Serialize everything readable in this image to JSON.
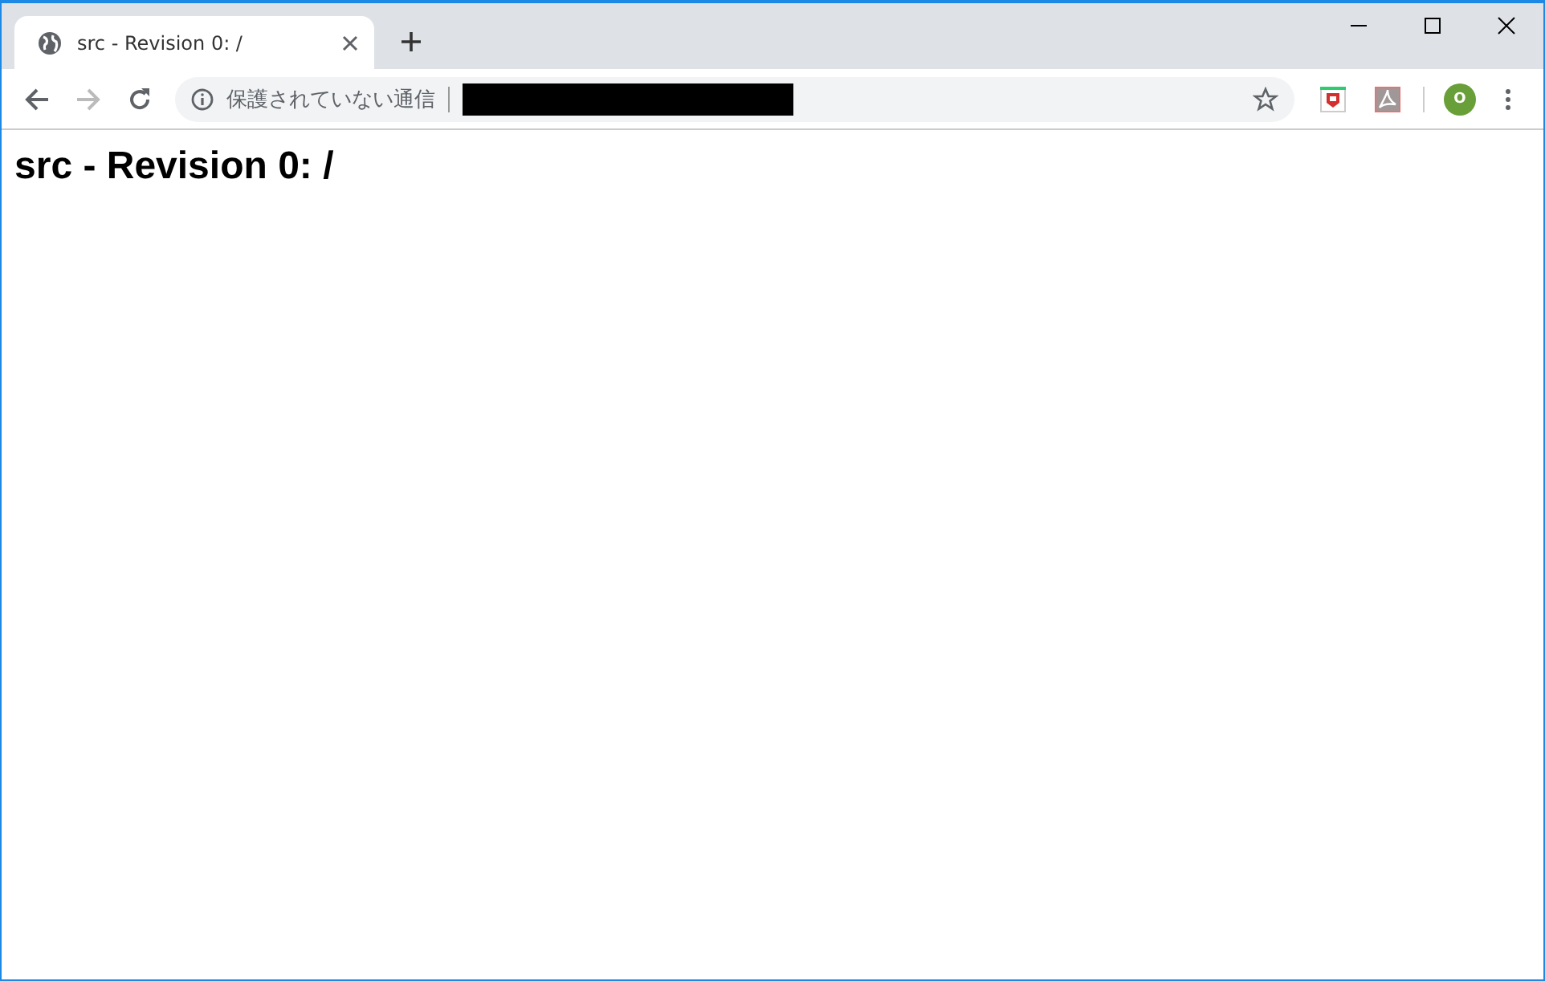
{
  "tabs": [
    {
      "title": "src - Revision 0: /",
      "selected": true
    }
  ],
  "nav_buttons": [
    {
      "kind": "back",
      "disabled": false
    },
    {
      "kind": "forward",
      "disabled": true
    },
    {
      "kind": "reload",
      "disabled": false
    }
  ],
  "address_bar": {
    "security_label": "保護されていない通信"
  },
  "profile": {
    "initial": "O"
  },
  "page": {
    "heading": "src - Revision 0: /"
  }
}
